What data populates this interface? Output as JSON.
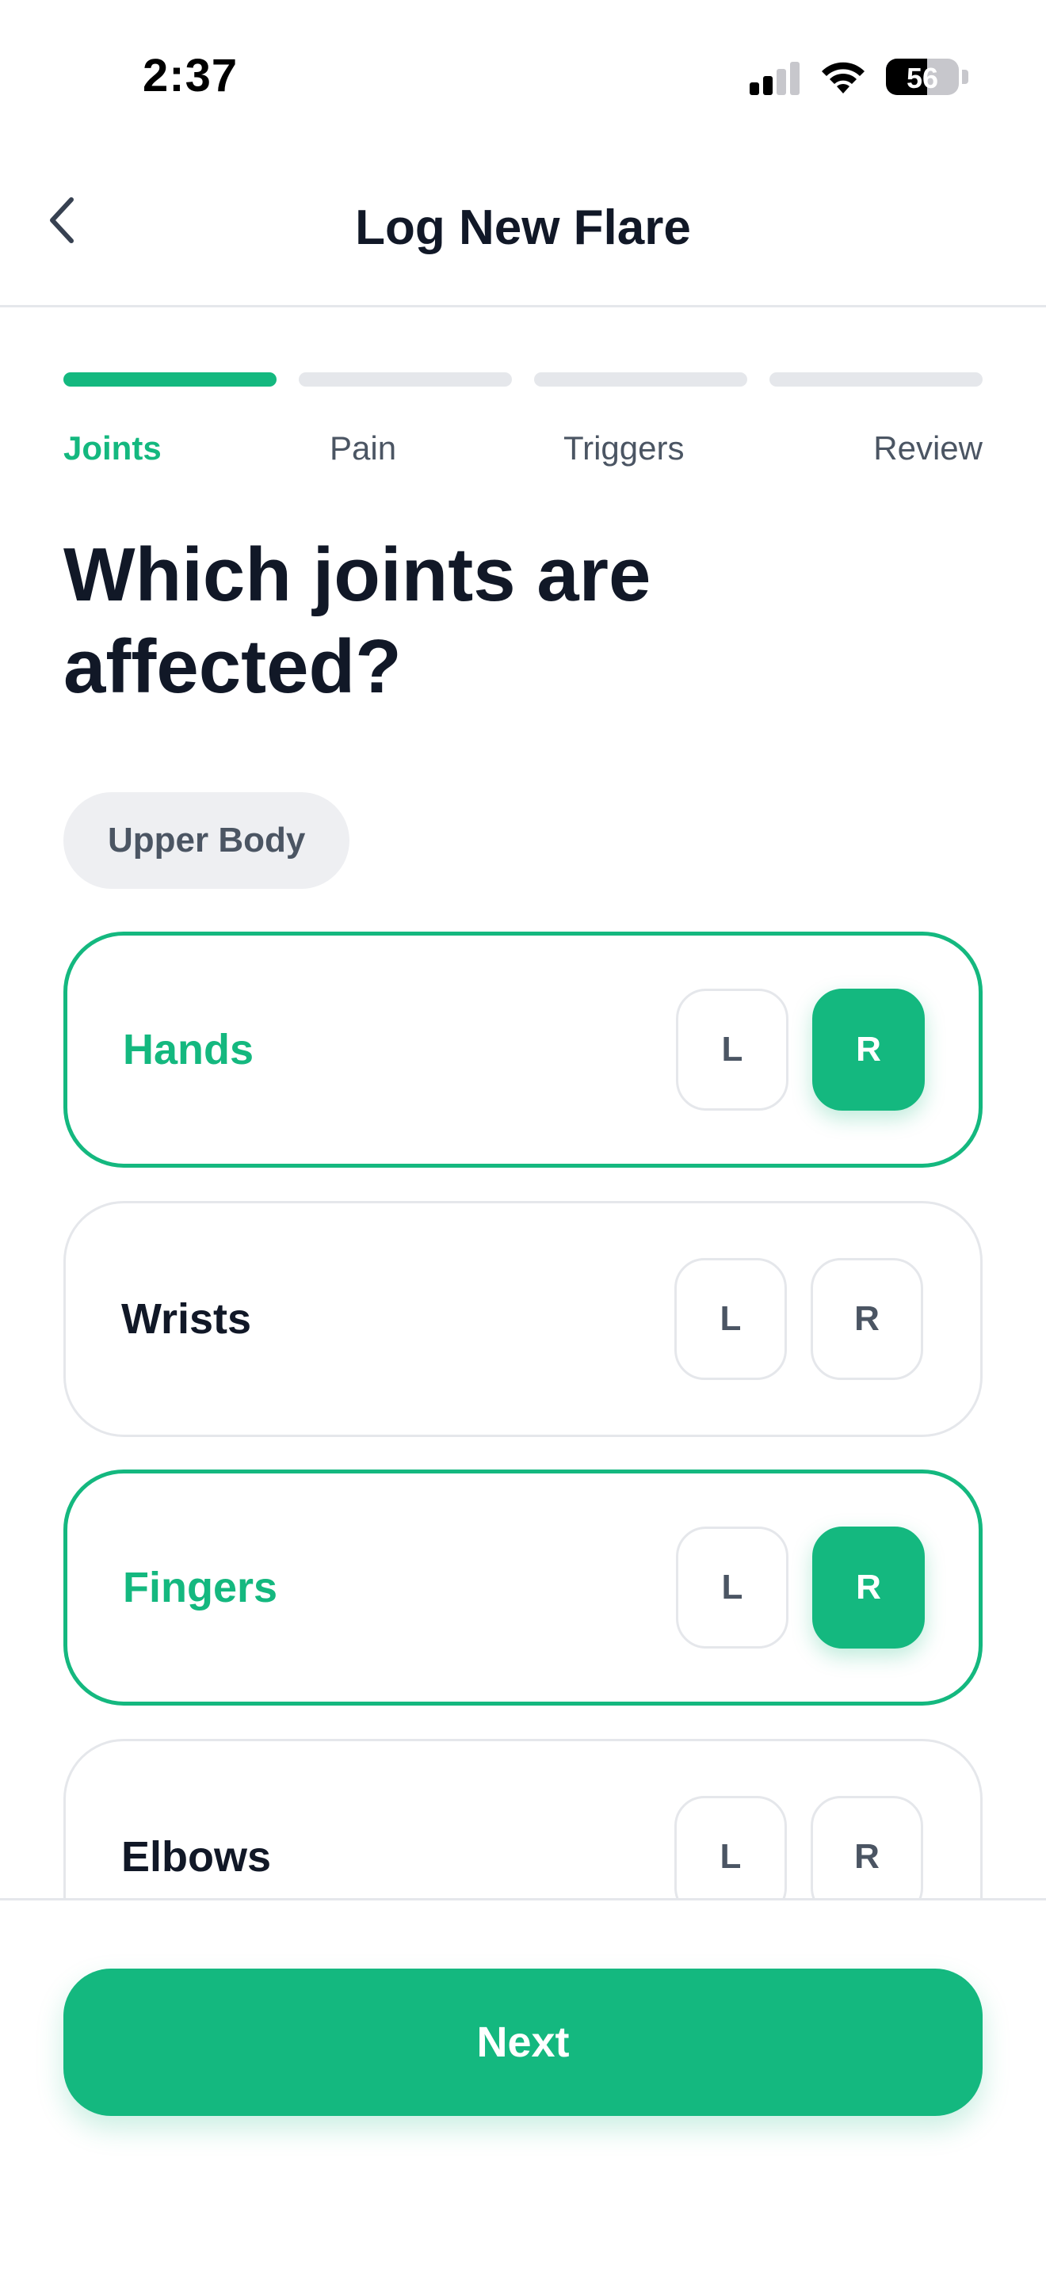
{
  "status_bar": {
    "time": "2:37",
    "battery_level": "56",
    "signal_icon": "cellular-signal-icon",
    "wifi_icon": "wifi-icon",
    "battery_icon": "battery-icon"
  },
  "header": {
    "back_icon": "chevron-left-icon",
    "title": "Log New Flare"
  },
  "stepper": {
    "current_step": 1,
    "steps": [
      {
        "label": "Joints",
        "active": true
      },
      {
        "label": "Pain",
        "active": false
      },
      {
        "label": "Triggers",
        "active": false
      },
      {
        "label": "Review",
        "active": false
      }
    ]
  },
  "question": "Which joints are affected?",
  "section": {
    "label": "Upper Body"
  },
  "joints": [
    {
      "name": "Hands",
      "selected": true,
      "left_label": "L",
      "right_label": "R",
      "left_on": false,
      "right_on": true
    },
    {
      "name": "Wrists",
      "selected": false,
      "left_label": "L",
      "right_label": "R",
      "left_on": false,
      "right_on": false
    },
    {
      "name": "Fingers",
      "selected": true,
      "left_label": "L",
      "right_label": "R",
      "left_on": false,
      "right_on": true
    },
    {
      "name": "Elbows",
      "selected": false,
      "left_label": "L",
      "right_label": "R",
      "left_on": false,
      "right_on": false
    }
  ],
  "footer": {
    "next_label": "Next"
  },
  "colors": {
    "accent": "#14b87f",
    "text_primary": "#111827",
    "text_secondary": "#4b5563",
    "border": "#e5e7eb",
    "chip_bg": "#eeeff2"
  }
}
